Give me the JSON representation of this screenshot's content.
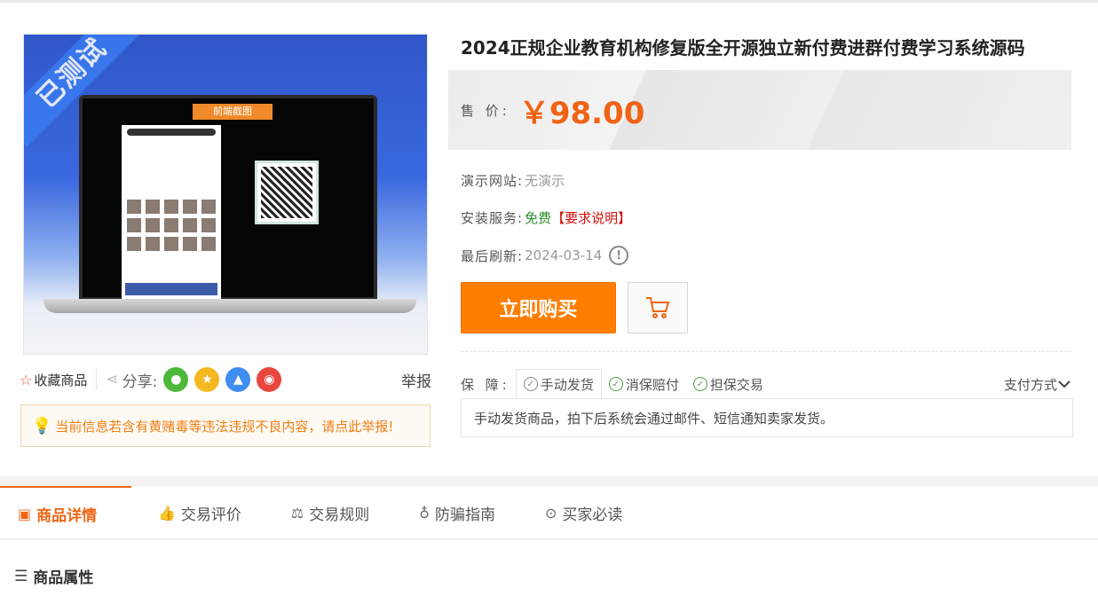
{
  "product": {
    "title": "2024正规企业教育机构修复版全开源独立新付费进群付费学习系统源码",
    "price_label": "售 价:",
    "price": "￥98.00",
    "demo_label": "演示网站:",
    "demo_value": "无演示",
    "install_label": "安装服务:",
    "install_value": "免费",
    "install_link": "【要求说明】",
    "refresh_label": "最后刷新:",
    "refresh_value": "2024-03-14",
    "buy_label": "立即购买"
  },
  "gallery": {
    "ribbon": "已测试",
    "screen_tag": "前端截图"
  },
  "actions": {
    "favorite": "收藏商品",
    "share": "分享:",
    "report": "举报"
  },
  "notice": "当前信息若含有黄赌毒等违法违规不良内容，请点此举报!",
  "guarantee": {
    "label": "保 障:",
    "items": [
      "手动发货",
      "消保赔付",
      "担保交易"
    ],
    "payment": "支付方式",
    "description": "手动发货商品，拍下后系统会通过邮件、短信通知卖家发货。"
  },
  "tabs": [
    "商品详情",
    "交易评价",
    "交易规则",
    "防骗指南",
    "买家必读"
  ],
  "section_title": "商品属性",
  "colors": {
    "accent": "#f06414",
    "buy": "#ff7e00"
  }
}
